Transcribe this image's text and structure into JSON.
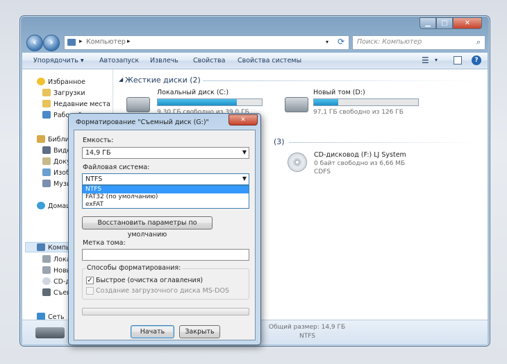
{
  "explorer": {
    "breadcrumb": "Компьютер",
    "search_placeholder": "Поиск: Компьютер",
    "toolbar": {
      "organize": "Упорядочить ▾",
      "autoplay": "Автозапуск",
      "eject": "Извлечь",
      "properties": "Свойства",
      "system_properties": "Свойства системы"
    },
    "nav": {
      "favorites": "Избранное",
      "downloads": "Загрузки",
      "recent": "Недавние места",
      "desktop": "Рабочий стол",
      "libraries": "Библиотеки",
      "videos": "Видео",
      "documents": "Документы",
      "images": "Изображения",
      "music": "Музыка",
      "homegroup": "Домашняя группа",
      "computer": "Компьютер",
      "local_disk": "Локальный диск",
      "new_volume": "Новый том",
      "cd_drive": "CD-дисковод",
      "removable": "Съемный диск",
      "network": "Сеть"
    },
    "groups": {
      "hard_drives": "Жесткие диски (2)",
      "removable_count": "(3)"
    },
    "drives": [
      {
        "name": "Локальный диск (C:)",
        "info": "9,30 ГБ свободно из 39,0 ГБ",
        "used_fraction": 0.76
      },
      {
        "name": "Новый том (D:)",
        "info": "97,1 ГБ свободно из 126 ГБ",
        "used_fraction": 0.23
      }
    ],
    "cd": {
      "name": "CD-дисковод (F:) LJ System",
      "info": "0 байт свободно из 6,66 МБ",
      "fs": "CDFS"
    },
    "details": {
      "total_size": "Общий размер: 14,9 ГБ",
      "fs": "NTFS"
    }
  },
  "dialog": {
    "title": "Форматирование \"Съемный диск (G:)\"",
    "close": "✕",
    "capacity_label": "Емкость:",
    "capacity_value": "14,9 ГБ",
    "fs_label": "Файловая система:",
    "fs_value": "NTFS",
    "fs_options": [
      "NTFS",
      "FAT32 (по умолчанию)",
      "exFAT"
    ],
    "restore_defaults": "Восстановить параметры по умолчанию",
    "volume_label": "Метка тома:",
    "volume_value": "",
    "format_options_label": "Способы форматирования:",
    "quick_format": "Быстрое (очистка оглавления)",
    "quick_format_checked": true,
    "boot_disk": "Создание загрузочного диска MS-DOS",
    "start": "Начать",
    "close_button": "Закрыть"
  }
}
